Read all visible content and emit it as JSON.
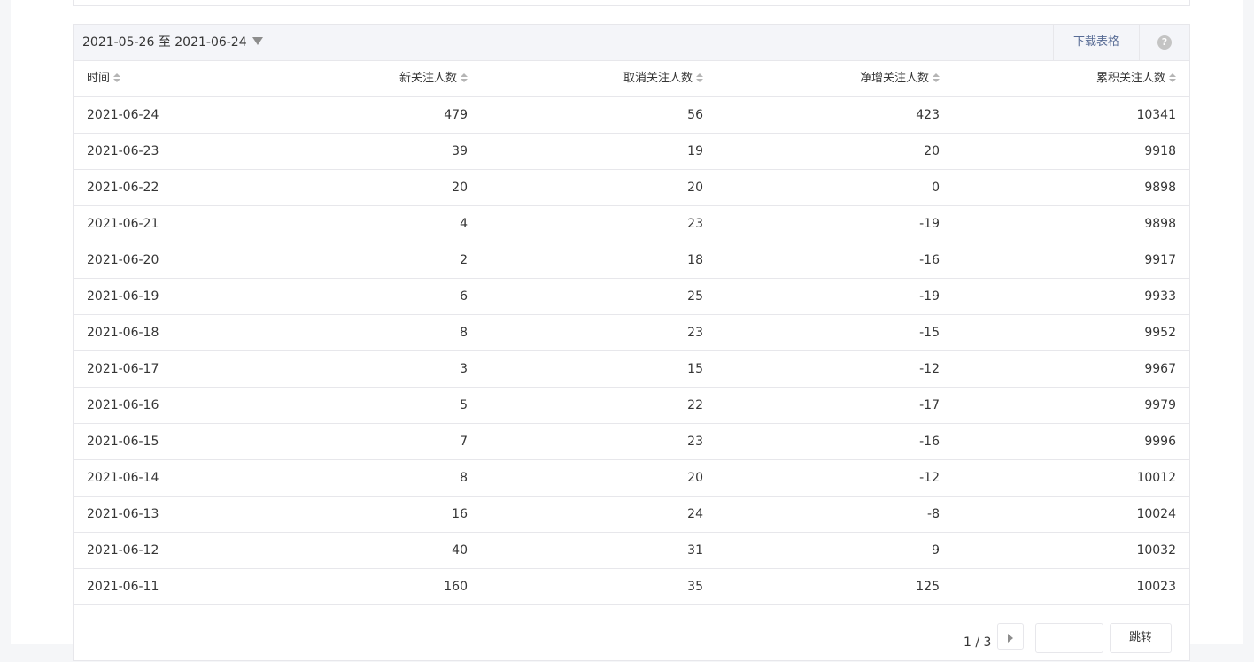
{
  "toolbar": {
    "date_range": "2021-05-26 至 2021-06-24",
    "download_label": "下载表格",
    "help_glyph": "?"
  },
  "table": {
    "headers": [
      "时间",
      "新关注人数",
      "取消关注人数",
      "净增关注人数",
      "累积关注人数"
    ],
    "rows": [
      [
        "2021-06-24",
        "479",
        "56",
        "423",
        "10341"
      ],
      [
        "2021-06-23",
        "39",
        "19",
        "20",
        "9918"
      ],
      [
        "2021-06-22",
        "20",
        "20",
        "0",
        "9898"
      ],
      [
        "2021-06-21",
        "4",
        "23",
        "-19",
        "9898"
      ],
      [
        "2021-06-20",
        "2",
        "18",
        "-16",
        "9917"
      ],
      [
        "2021-06-19",
        "6",
        "25",
        "-19",
        "9933"
      ],
      [
        "2021-06-18",
        "8",
        "23",
        "-15",
        "9952"
      ],
      [
        "2021-06-17",
        "3",
        "15",
        "-12",
        "9967"
      ],
      [
        "2021-06-16",
        "5",
        "22",
        "-17",
        "9979"
      ],
      [
        "2021-06-15",
        "7",
        "23",
        "-16",
        "9996"
      ],
      [
        "2021-06-14",
        "8",
        "20",
        "-12",
        "10012"
      ],
      [
        "2021-06-13",
        "16",
        "24",
        "-8",
        "10024"
      ],
      [
        "2021-06-12",
        "40",
        "31",
        "9",
        "10032"
      ],
      [
        "2021-06-11",
        "160",
        "35",
        "125",
        "10023"
      ]
    ]
  },
  "pagination": {
    "page_text": "1 / 3",
    "jump_input_value": "",
    "jump_label": "跳转"
  },
  "colors": {
    "link": "#576b95",
    "border": "#e7e7eb",
    "toolbar_bg": "#f4f5f9",
    "text": "#353535"
  }
}
